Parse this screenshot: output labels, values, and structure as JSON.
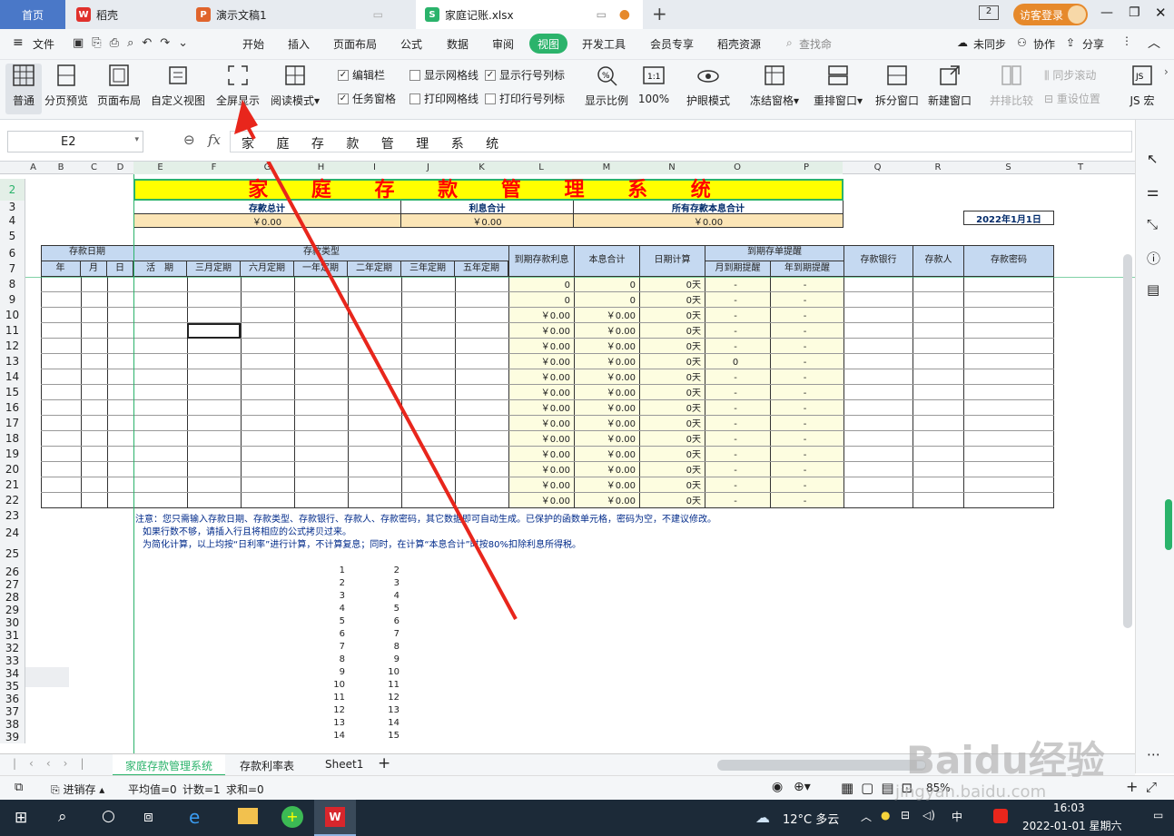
{
  "tabs": {
    "home": "首页",
    "daoke": "稻壳",
    "ppt": "演示文稿1",
    "xlsx": "家庭记账.xlsx",
    "new_tab": "+",
    "visitor": "访客登录",
    "box_num": "2"
  },
  "menu": {
    "file": "文件",
    "items": [
      "开始",
      "插入",
      "页面布局",
      "公式",
      "数据",
      "审阅",
      "视图",
      "开发工具",
      "会员专享",
      "稻壳资源"
    ],
    "search": "查找命",
    "sync": "未同步",
    "collab": "协作",
    "share": "分享"
  },
  "ribbon": {
    "normal": "普通",
    "page_break": "分页预览",
    "page_layout": "页面布局",
    "custom_view": "自定义视图",
    "fullscreen": "全屏显示",
    "reading": "阅读模式",
    "edit_bar": "编辑栏",
    "task_pane": "任务窗格",
    "show_grid": "显示网格线",
    "print_grid": "打印网格线",
    "show_rowcol": "显示行号列标",
    "print_rowcol": "打印行号列标",
    "zoom_ratio": "显示比例",
    "zoom100": "100%",
    "eye": "护眼模式",
    "freeze": "冻结窗格",
    "rearrange": "重排窗口",
    "split": "拆分窗口",
    "new_window": "新建窗口",
    "side_by_side": "并排比较",
    "sync_scroll": "同步滚动",
    "reset_pos": "重设位置",
    "js_macro": "JS 宏"
  },
  "formula": {
    "cellref": "E2",
    "fx": "fx",
    "content": "家 庭 存 款 管 理 系 统"
  },
  "columns": [
    "A",
    "B",
    "C",
    "D",
    "E",
    "F",
    "G",
    "H",
    "I",
    "J",
    "K",
    "L",
    "M",
    "N",
    "O",
    "P",
    "Q",
    "R",
    "S",
    "T"
  ],
  "rows": [
    "2",
    "3",
    "4",
    "5",
    "6",
    "7",
    "8",
    "9",
    "10",
    "11",
    "12",
    "13",
    "14",
    "15",
    "16",
    "17",
    "18",
    "19",
    "20",
    "21",
    "22",
    "23",
    "24",
    "25",
    "26",
    "27",
    "28",
    "29",
    "30",
    "31",
    "32",
    "33",
    "34",
    "35",
    "36",
    "37",
    "38",
    "39"
  ],
  "sheet": {
    "title": "家 庭 存 款 管 理 系 统",
    "summary_labels": [
      "存款总计",
      "利息合计",
      "所有存款本息合计"
    ],
    "summary_values": [
      "￥0.00",
      "￥0.00",
      "￥0.00"
    ],
    "date": "2022年1月1日",
    "hdr_date": "存款日期",
    "hdr_type": "存款类型",
    "hdr_date_sub": [
      "年",
      "月",
      "日"
    ],
    "hdr_type_sub": [
      "活　期",
      "三月定期",
      "六月定期",
      "一年定期",
      "二年定期",
      "三年定期",
      "五年定期"
    ],
    "hdr_interest": "到期存款利息",
    "hdr_total": "本息合计",
    "hdr_days": "日期计算",
    "hdr_early": "到期存单提醒",
    "hdr_early_sub": [
      "月到期提醒",
      "年到期提醒"
    ],
    "hdr_bank": "存款银行",
    "hdr_person": "存款人",
    "hdr_pwd": "存款密码",
    "data_rows": [
      [
        "0",
        "0",
        "0天",
        "-",
        "-"
      ],
      [
        "0",
        "0",
        "0天",
        "-",
        "-"
      ],
      [
        "￥0.00",
        "￥0.00",
        "0天",
        "-",
        "-"
      ],
      [
        "￥0.00",
        "￥0.00",
        "0天",
        "-",
        "-"
      ],
      [
        "￥0.00",
        "￥0.00",
        "0天",
        "-",
        "-"
      ],
      [
        "￥0.00",
        "￥0.00",
        "0天",
        "0",
        "-"
      ],
      [
        "￥0.00",
        "￥0.00",
        "0天",
        "-",
        "-"
      ],
      [
        "￥0.00",
        "￥0.00",
        "0天",
        "-",
        "-"
      ],
      [
        "￥0.00",
        "￥0.00",
        "0天",
        "-",
        "-"
      ],
      [
        "￥0.00",
        "￥0.00",
        "0天",
        "-",
        "-"
      ],
      [
        "￥0.00",
        "￥0.00",
        "0天",
        "-",
        "-"
      ],
      [
        "￥0.00",
        "￥0.00",
        "0天",
        "-",
        "-"
      ],
      [
        "￥0.00",
        "￥0.00",
        "0天",
        "-",
        "-"
      ],
      [
        "￥0.00",
        "￥0.00",
        "0天",
        "-",
        "-"
      ],
      [
        "￥0.00",
        "￥0.00",
        "0天",
        "-",
        "-"
      ]
    ],
    "notes": [
      "注意：您只需输入存款日期、存款类型、存款银行、存款人、存款密码，其它数据即可自动生成。已保护的函数单元格，密码为空，不建议修改。",
      "如果行数不够，请插入行且将相应的公式拷贝过来。",
      "为简化计算，以上均按“日利率”进行计算，不计算复息；同时，在计算“本息合计”时按80%扣除利息所得税。"
    ],
    "list_a": [
      "1",
      "2",
      "3",
      "4",
      "5",
      "6",
      "7",
      "8",
      "9",
      "10",
      "11",
      "12",
      "13",
      "14"
    ],
    "list_b": [
      "2",
      "3",
      "4",
      "5",
      "6",
      "7",
      "8",
      "9",
      "10",
      "11",
      "12",
      "13",
      "14",
      "15"
    ]
  },
  "sheet_tabs": [
    "家庭存款管理系统",
    "存款利率表",
    "Sheet1"
  ],
  "status": {
    "save": "进销存",
    "avg": "平均值=0",
    "count": "计数=1",
    "sum": "求和=0",
    "zoom": "85%"
  },
  "taskbar": {
    "weather": "12°C 多云",
    "time": "16:03",
    "date": "2022-01-01 星期六",
    "ime": "中"
  },
  "watermark": "Baidu经验",
  "watermark_sub": "jingyan.baidu.com",
  "colors": {
    "accent": "#2bb36b",
    "title_bg": "#ffff00",
    "title_fg": "#ff0000",
    "header_bg": "#c5d9f1",
    "summary_bg": "#fbe5b6",
    "calc_bg": "#fdfde0",
    "arrow": "#e8261c"
  }
}
